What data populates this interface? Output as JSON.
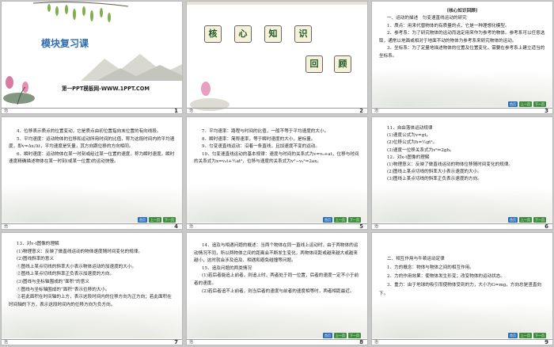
{
  "footer_mark": "治",
  "nav": {
    "home": "首页",
    "prev": "上一页",
    "next": "下一页"
  },
  "slide1": {
    "title": "模块复习课",
    "subtitle": "第一PPT模板网-WWW.1PPT.COM",
    "num": "1"
  },
  "slide2": {
    "chars": [
      "核",
      "心",
      "知",
      "识",
      "回",
      "顾"
    ],
    "num": "2"
  },
  "slide3": {
    "header": "[核心知识回顾]",
    "lines": [
      "一、运动的描述　匀变速直线运动的研究",
      "1．质点：用来代替物体的有质量的点，它是一种理想化模型。",
      "2．参考系：为了研究物体的运动而选定用来作为参考的物体。参考系可以任意选取，通常以地面或相对于地面不动的物体为参考系来研究物体的运动。",
      "3．坐标系：为了定量地描述物体的位置及位置变化，需要在参考系上建立适当的坐标系。"
    ],
    "num": "3"
  },
  "slide4": {
    "lines": [
      "4．位移表示质点的位置变动，它是质点由初位置指向末位置的有向线段。",
      "5．平均速度：运动物体的位移和运动所用时间的比值，称为这段时间内的平均速度，即v=Δx/Δt，平均速度是矢量，其方向跟位移的方向相同。",
      "6．瞬时速度：运动物体在某一时刻或经过某一位置的速度，称为瞬时速度。瞬时速度精确描述物体在某一时刻(或某一位置)的运动快慢。"
    ],
    "num": "4"
  },
  "slide5": {
    "lines": [
      "7．平均速率：路程与时间的比值，一般不等于平均速度的大小。",
      "8．瞬时速率：简称速率，等于瞬时速度的大小，是标量。",
      "9．匀变速直线运动：沿着一条直线，且加速度不变的运动。",
      "10．匀变速直线运动的基本规律：速度与时间的关系式为v=v₀+at，位移与时间的关系式为x=v₀t+½at²，位移与速度的关系式为v²−v₀²=2ax。"
    ],
    "num": "5"
  },
  "slide6": {
    "lines": [
      "11．自由落体运动规律",
      "(1)速度公式为v=gt。",
      "(2)位移公式为h=½gt²。",
      "(3)速度一位移关系式为v²=2gh。",
      "12．对x-t图像的理解",
      "(1)物理意义：反映了做直线运动的物体位移随时间变化的规律。",
      "(2)图线上某点切线的斜率大小表示速度的大小。",
      "(3)图线上某点切线的斜率正负表示速度的方向。"
    ],
    "num": "6"
  },
  "slide7": {
    "lines": [
      "13．对v-t图像的理解",
      "(1)物理意义：反映了做直线运动的物体速度随时间变化的规律。",
      "(2)图线斜率的意义",
      "①图线上某点切线的斜率大小表示物体运动的加速度的大小。",
      "②图线上某点切线的斜率正负表示加速度的方向。",
      "(3)图线与坐标轴围成的“面积”的意义",
      "①图线与坐标轴围成的“面积”表示位移的大小。",
      "②若此面积在时间轴的上方，表示这段时间内的位移方向为正方向；若此面积在时间轴的下方，表示这段时间内的位移方向为负方向。"
    ],
    "num": "7"
  },
  "slide8": {
    "lines": [
      "14．追及与相遇问题的概述：当两个物体在同一直线上运动时，由于两物体的运动情况不同，所以两物体之间的距离会不断发生变化，两物体间距或越来越大或越来越小，这时就会涉及追及、相遇和避免碰撞等问题。",
      "15．追及问题的两类情况",
      "(1)若后者能追上前者，则追上时，两者处于同一位置，后者的速度一定不小于前者的速度。",
      "(2)若后者追不上前者，则当后者的速度与前者的速度相等时，两者相距最近。"
    ],
    "num": "8"
  },
  "slide9": {
    "lines": [
      "二、相互作用与牛顿运动定律",
      "1．力的概念：物体与物体之间的相互作用。",
      "2．力的作用效果：使物体发生形变；改变物体的运动状态。",
      "3．重力：由于地球的吸引而使物体受到的力，大小为G=mg，方向总是竖直向下。"
    ],
    "num": "9"
  }
}
